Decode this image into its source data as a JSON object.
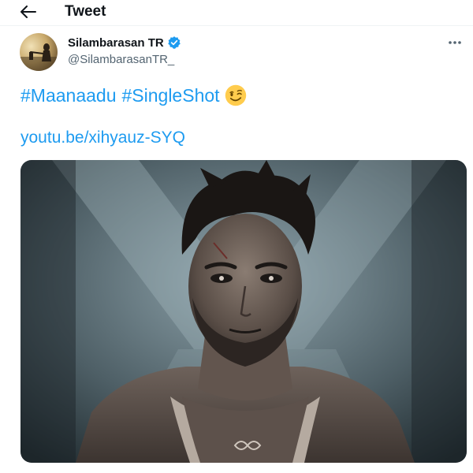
{
  "header": {
    "title": "Tweet",
    "back_icon": "arrow-left-icon"
  },
  "author": {
    "display_name": "Silambarasan TR",
    "handle": "@SilambarasanTR_",
    "verified": true,
    "verified_color": "#1d9bf0"
  },
  "tweet": {
    "hashtags": [
      "#Maanaadu",
      "#SingleShot"
    ],
    "emoji": "winking-face",
    "link": "youtu.be/xihyauz-SYQ"
  },
  "colors": {
    "link": "#1d9bf0",
    "text": "#0f1419",
    "secondary": "#536471"
  }
}
